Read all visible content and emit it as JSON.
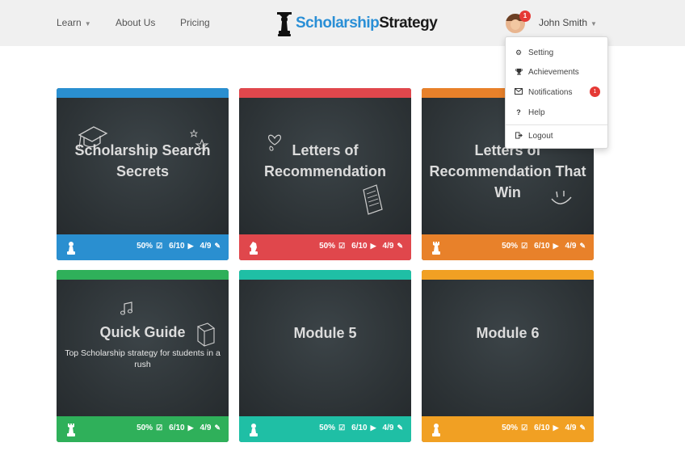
{
  "header": {
    "nav": [
      {
        "label": "Learn",
        "has_caret": true
      },
      {
        "label": "About Us",
        "has_caret": false
      },
      {
        "label": "Pricing",
        "has_caret": false
      }
    ],
    "logo": {
      "part1": "Scholarship",
      "part2": "Strategy",
      "icon": "chess-king-icon"
    },
    "user": {
      "name": "John Smith",
      "badge_count": "1",
      "avatar_icon": "avatar"
    }
  },
  "user_menu": {
    "items": [
      {
        "label": "Setting",
        "icon": "gear-icon"
      },
      {
        "label": "Achievements",
        "icon": "trophy-icon"
      },
      {
        "label": "Notifications",
        "icon": "envelope-icon",
        "badge": "1"
      },
      {
        "label": "Help",
        "icon": "question-icon"
      },
      {
        "label": "Logout",
        "icon": "logout-icon"
      }
    ]
  },
  "cards": [
    {
      "title": "Scholarship Search Secrets",
      "subtitle": "",
      "color": "#2a8fd0",
      "progress": "50%",
      "tasks": "6/10",
      "videos": "4/9",
      "piece": "pawn"
    },
    {
      "title": "Letters of Recommendation",
      "subtitle": "",
      "color": "#e0474c",
      "progress": "50%",
      "tasks": "6/10",
      "videos": "4/9",
      "piece": "knight"
    },
    {
      "title": "Letters of Recommendation That Win",
      "subtitle": "",
      "color": "#e8812a",
      "progress": "50%",
      "tasks": "6/10",
      "videos": "4/9",
      "piece": "rook"
    },
    {
      "title": "Quick Guide",
      "subtitle": "Top Scholarship strategy for students in a rush",
      "color": "#2fb05a",
      "progress": "50%",
      "tasks": "6/10",
      "videos": "4/9",
      "piece": "rook"
    },
    {
      "title": "Module 5",
      "subtitle": "",
      "color": "#1fbfa5",
      "progress": "50%",
      "tasks": "6/10",
      "videos": "4/9",
      "piece": "pawn"
    },
    {
      "title": "Module 6",
      "subtitle": "",
      "color": "#f1a023",
      "progress": "50%",
      "tasks": "6/10",
      "videos": "4/9",
      "piece": "pawn"
    }
  ]
}
